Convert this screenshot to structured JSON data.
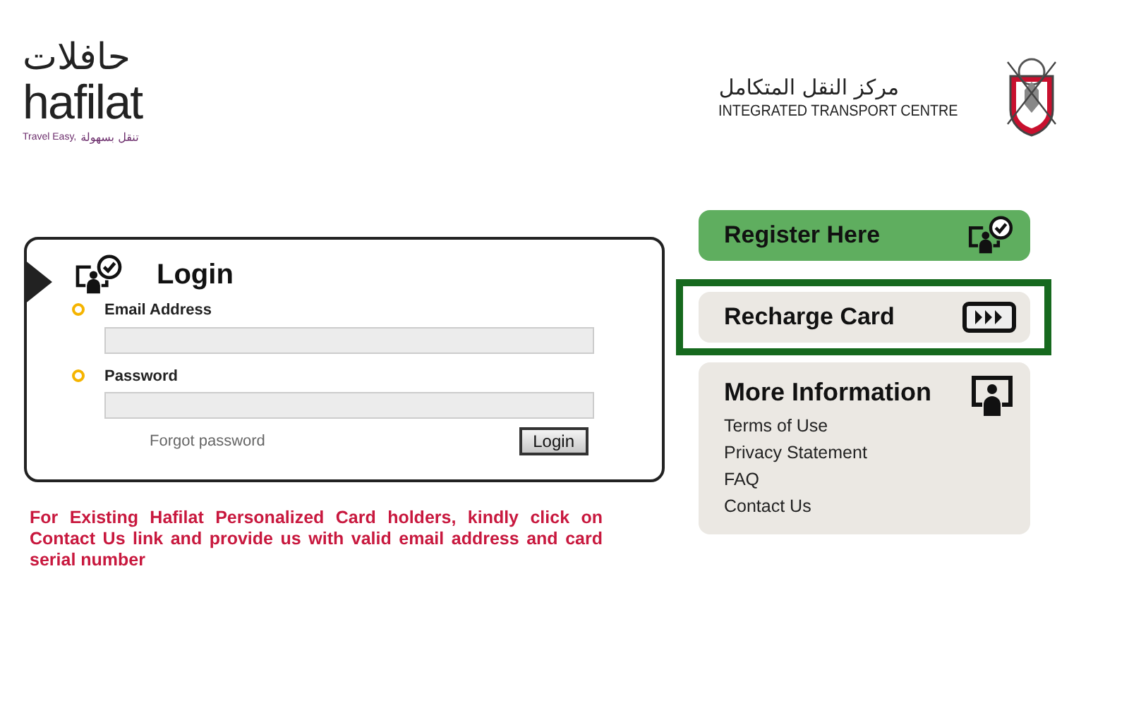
{
  "brand": {
    "arabic_name": "حافلات",
    "name": "hafilat",
    "tagline_en": "Travel Easy,",
    "tagline_ar": "تنقل بسهولة"
  },
  "partner": {
    "arabic_name": "مركز النقل المتكامل",
    "name": "INTEGRATED TRANSPORT CENTRE"
  },
  "login": {
    "title": "Login",
    "fields": [
      {
        "label": "Email Address"
      },
      {
        "label": "Password"
      }
    ],
    "forgot_link": "Forgot password",
    "submit": "Login"
  },
  "notice": "For Existing Hafilat Personalized Card holders, kindly click on Contact Us link and provide us with valid email address and card serial number",
  "actions": [
    {
      "label": "Register Here",
      "kind": "primary",
      "highlighted": false
    },
    {
      "label": "Recharge Card",
      "kind": "secondary",
      "highlighted": true
    }
  ],
  "more_info": {
    "title": "More Information",
    "links": [
      "Terms of Use",
      "Privacy Statement",
      "FAQ",
      "Contact Us"
    ]
  }
}
